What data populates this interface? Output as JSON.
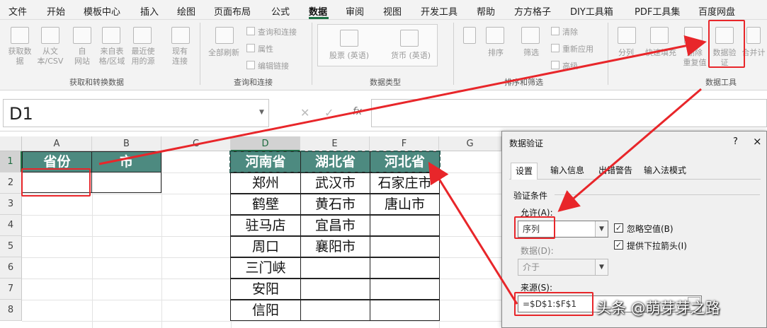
{
  "menu": [
    "文件",
    "开始",
    "模板中心",
    "插入",
    "绘图",
    "页面布局",
    "公式",
    "数据",
    "审阅",
    "视图",
    "开发工具",
    "帮助",
    "方方格子",
    "DIY工具箱",
    "PDF工具集",
    "百度网盘"
  ],
  "ribbon": {
    "get_data": "获取数\n据",
    "from_text": "从文\n本/CSV",
    "from_web": "自\n网站",
    "from_table": "来自表\n格/区域",
    "recent_sources": "最近使\n用的源",
    "existing_conn": "现有\n连接",
    "refresh_all": "全部刷新",
    "queries_conn": "查询和连接",
    "properties": "属性",
    "edit_links": "编辑链接",
    "stocks": "股票 (英语)",
    "currency": "货币 (英语)",
    "sort": "排序",
    "filter": "筛选",
    "clear": "清除",
    "reapply": "重新应用",
    "advanced": "高级",
    "text_to_cols": "分列",
    "flash_fill": "快速填充",
    "remove_dup": "删除\n重复值",
    "data_validation": "数据验\n证",
    "consolidate": "合并计",
    "groups": {
      "get_transform": "获取和转换数据",
      "queries": "查询和连接",
      "data_types": "数据类型",
      "sort_filter": "排序和筛选",
      "data_tools": "数据工具"
    }
  },
  "formula_bar": {
    "name_box": "D1",
    "fx": "fx",
    "formula": ""
  },
  "sheet": {
    "columns": [
      "A",
      "B",
      "C",
      "D",
      "E",
      "F",
      "G"
    ],
    "rows": [
      "1",
      "2",
      "3",
      "4",
      "5",
      "6",
      "7",
      "8"
    ],
    "a1": "省份",
    "b1": "市",
    "table_headers": [
      "河南省",
      "湖北省",
      "河北省"
    ],
    "henan": [
      "郑州",
      "鹤壁",
      "驻马店",
      "周口",
      "三门峡",
      "安阳",
      "信阳"
    ],
    "hubei": [
      "武汉市",
      "黄石市",
      "宜昌市",
      "襄阳市"
    ],
    "hebei": [
      "石家庄市",
      "唐山市"
    ]
  },
  "dialog": {
    "title": "数据验证",
    "help": "?",
    "close": "×",
    "tabs": [
      "设置",
      "输入信息",
      "出错警告",
      "输入法模式"
    ],
    "criteria": "验证条件",
    "allow_label": "允许(A):",
    "allow_value": "序列",
    "ignore_blank": "忽略空值(B)",
    "dropdown": "提供下拉箭头(I)",
    "data_label": "数据(D):",
    "data_value": "介于",
    "source_label": "来源(S):",
    "source_value": "=$D$1:$F$1"
  },
  "watermark": "头条 @萌芽芽之路",
  "colors": {
    "header_fill": "#4d8a80",
    "accent": "#217346",
    "highlight": "#e8262a"
  }
}
